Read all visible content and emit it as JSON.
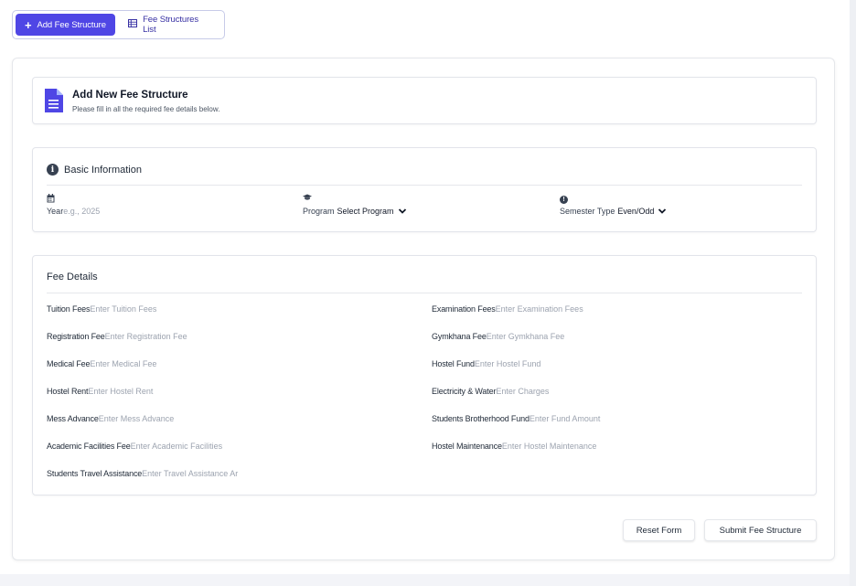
{
  "tabs": {
    "add_label": "Add Fee Structure",
    "list_label": "Fee Structures List"
  },
  "header": {
    "title": "Add New Fee Structure",
    "subtitle": "Please fill in all the required fee details below."
  },
  "basic": {
    "title": "Basic Information",
    "year": {
      "label": "Year",
      "placeholder": "e.g., 2025",
      "icon": "calendar-icon"
    },
    "program": {
      "label": "Program",
      "value": "Select Program",
      "icon": "graduation-cap-icon"
    },
    "semester": {
      "label": "Semester Type",
      "value": "Even/Odd",
      "icon": "info-icon"
    }
  },
  "fees": {
    "title": "Fee Details",
    "left": [
      {
        "label": "Tuition Fees",
        "placeholder": "Enter Tuition Fees"
      },
      {
        "label": "Registration Fee",
        "placeholder": "Enter Registration Fee"
      },
      {
        "label": "Medical Fee",
        "placeholder": "Enter Medical Fee"
      },
      {
        "label": "Hostel Rent",
        "placeholder": "Enter Hostel Rent"
      },
      {
        "label": "Mess Advance",
        "placeholder": "Enter Mess Advance"
      },
      {
        "label": "Academic Facilities Fee",
        "placeholder": "Enter Academic Facilities"
      },
      {
        "label": "Students Travel Assistance",
        "placeholder": "Enter Travel Assistance Ar"
      }
    ],
    "right": [
      {
        "label": "Examination Fees",
        "placeholder": "Enter Examination Fees"
      },
      {
        "label": "Gymkhana Fee",
        "placeholder": "Enter Gymkhana Fee"
      },
      {
        "label": "Hostel Fund",
        "placeholder": "Enter Hostel Fund"
      },
      {
        "label": "Electricity & Water",
        "placeholder": "Enter Charges"
      },
      {
        "label": "Students Brotherhood Fund",
        "placeholder": "Enter Fund Amount"
      },
      {
        "label": "Hostel Maintenance",
        "placeholder": "Enter Hostel Maintenance"
      }
    ]
  },
  "actions": {
    "reset_label": "Reset Form",
    "submit_label": "Submit Fee Structure"
  },
  "colors": {
    "accent": "#4f46e5",
    "placeholder": "#9ca3af"
  }
}
